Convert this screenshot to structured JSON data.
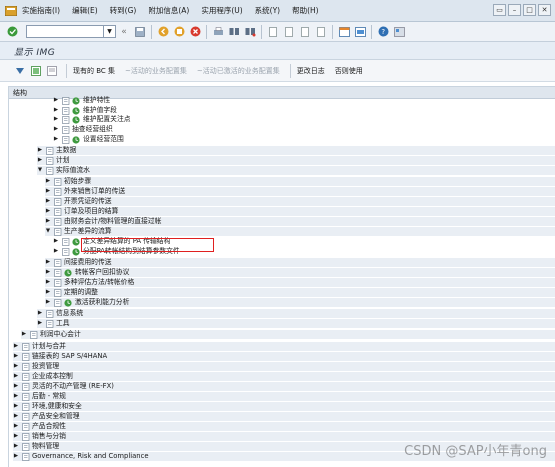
{
  "menubar": {
    "items": [
      "实施指南(I)",
      "编辑(E)",
      "转到(G)",
      "附加信息(A)",
      "实用程序(U)",
      "系统(Y)",
      "帮助(H)"
    ]
  },
  "title": "显示 IMG",
  "apptoolbar": {
    "existing_bc": "现有的 BC 集",
    "active_bc": "~活动的业务配置集",
    "activated_bc": "~活动已激活的业务配置集",
    "change_log": "更改日志",
    "usage": "否则使用"
  },
  "tree": {
    "header": "结构",
    "rows": [
      {
        "label": "维护特性"
      },
      {
        "label": "维护值字段"
      },
      {
        "label": "维护配置关注点"
      },
      {
        "label": "抽查经营组织"
      },
      {
        "label": "设置经营范围"
      },
      {
        "label": "主数据"
      },
      {
        "label": "计划"
      },
      {
        "label": "实际值流水"
      },
      {
        "label": "初始步骤"
      },
      {
        "label": "外来销售订单的传送"
      },
      {
        "label": "开票凭证的传送"
      },
      {
        "label": "订单及项目的结算"
      },
      {
        "label": "由财务会计/物料管理的直接过帐"
      },
      {
        "label": "生产差异的流算"
      },
      {
        "label": "定义差异结算的 PA 传输结构"
      },
      {
        "label": "分配PA转帐结构到结算参数文件"
      },
      {
        "label": "间接费用的传送"
      },
      {
        "label": "转帐客户回扣协议"
      },
      {
        "label": "多种评估方法/转帐价格"
      },
      {
        "label": "定期的调整"
      },
      {
        "label": "激活获利能力分析"
      },
      {
        "label": "信息系统"
      },
      {
        "label": "工具"
      },
      {
        "label": "利润中心会计"
      },
      {
        "label": "计划与合并"
      },
      {
        "label": "链接表的 SAP S/4HANA"
      },
      {
        "label": "投资管理"
      },
      {
        "label": "企业成本控制"
      },
      {
        "label": "灵活的不动产管理 (RE-FX)"
      },
      {
        "label": "后勤 - 常规"
      },
      {
        "label": "环境,健康和安全"
      },
      {
        "label": "产品安全和管理"
      },
      {
        "label": "产品合规性"
      },
      {
        "label": "销售与分销"
      },
      {
        "label": "物料管理"
      },
      {
        "label": "Governance, Risk and Compliance"
      }
    ]
  },
  "watermark": "CSDN @SAP小年青ong",
  "colors": {
    "highlight": "#e02020",
    "menubar": "#dde6ef"
  }
}
